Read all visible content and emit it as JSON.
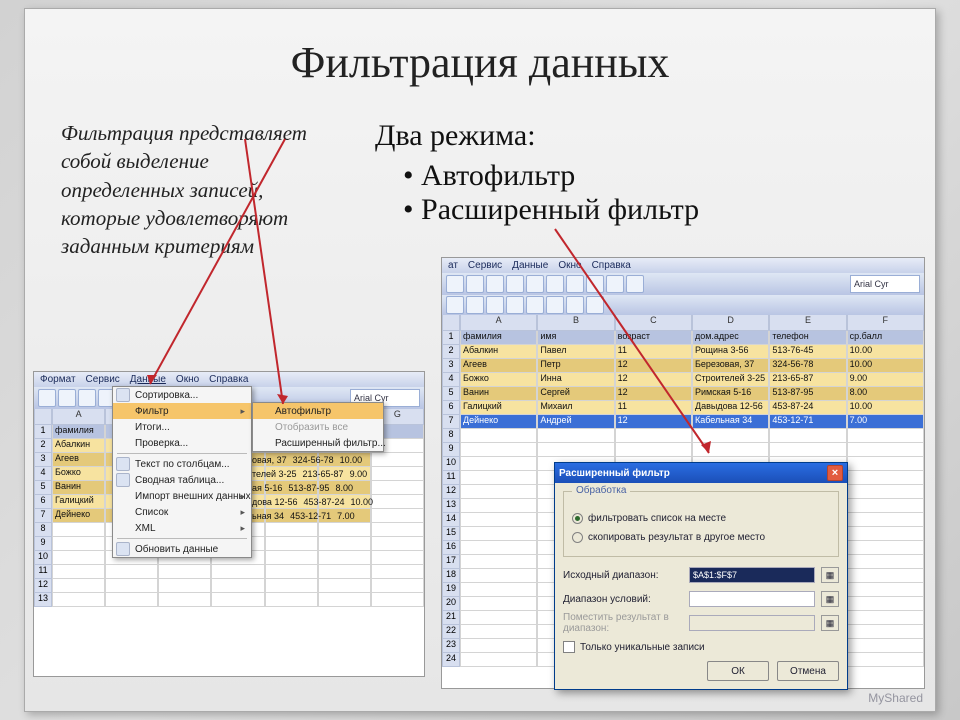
{
  "slide": {
    "title": "Фильтрация данных",
    "definition": "Фильтрация представляет собой выделение определенных записей, которые удовлетворяют заданным критериям",
    "modes_heading": "Два режима:",
    "modes": [
      "Автофильтр",
      "Расширенный фильтр"
    ]
  },
  "excel_common": {
    "menu": [
      "Формат",
      "Сервис",
      "Данные",
      "Окно",
      "Справка"
    ],
    "font_name": "Arial Cyr",
    "cols": [
      "A",
      "B",
      "C",
      "D",
      "E",
      "F"
    ],
    "headers": [
      "фамилия",
      "имя",
      "возраст",
      "дом.адрес",
      "телефон",
      "ср.балл"
    ],
    "rows": [
      [
        "Абалкин",
        "Павел",
        "11",
        "Рощина 3-56",
        "513-76-45",
        "10.00"
      ],
      [
        "Агеев",
        "Петр",
        "12",
        "Березовая, 37",
        "324-56-78",
        "10.00"
      ],
      [
        "Божко",
        "Инна",
        "12",
        "Строителей 3-25",
        "213-65-87",
        "9.00"
      ],
      [
        "Ванин",
        "Сергей",
        "12",
        "Римская 5-16",
        "513-87-95",
        "8.00"
      ],
      [
        "Галицкий",
        "Михаил",
        "11",
        "Давыдова 12-56",
        "453-87-24",
        "10.00"
      ],
      [
        "Дейнеко",
        "Андрей",
        "12",
        "Кабельная 34",
        "453-12-71",
        "7.00"
      ]
    ]
  },
  "data_dropdown": {
    "items": [
      {
        "label": "Сортировка...",
        "icon": true
      },
      {
        "label": "Фильтр",
        "arrow": true,
        "hi": true
      },
      {
        "label": "Итоги..."
      },
      {
        "label": "Проверка..."
      },
      {
        "label": "Текст по столбцам...",
        "icon": true
      },
      {
        "label": "Сводная таблица...",
        "icon": true
      },
      {
        "label": "Импорт внешних данных",
        "arrow": true
      },
      {
        "label": "Список",
        "arrow": true
      },
      {
        "label": "XML",
        "arrow": true
      },
      {
        "label": "Обновить данные",
        "icon": true
      }
    ],
    "sub": [
      {
        "label": "Автофильтр",
        "hi": true
      },
      {
        "label": "Отобразить все"
      },
      {
        "label": "Расширенный фильтр..."
      }
    ]
  },
  "dialog": {
    "title": "Расширенный фильтр",
    "group_title": "Обработка",
    "radio1": "фильтровать список на месте",
    "radio2": "скопировать результат в другое место",
    "lab_src": "Исходный диапазон:",
    "val_src": "$A$1:$F$7",
    "lab_cond": "Диапазон условий:",
    "lab_dest": "Поместить результат в диапазон:",
    "chk": "Только уникальные записи",
    "ok": "ОК",
    "cancel": "Отмена"
  },
  "watermark": "MyShared"
}
